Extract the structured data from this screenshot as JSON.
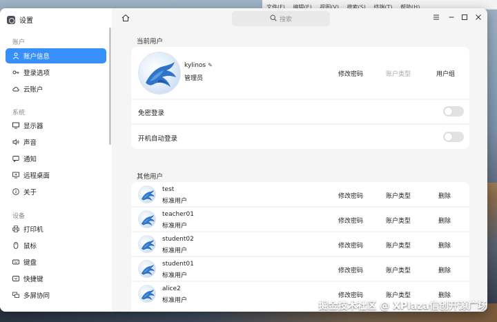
{
  "background_menubar": [
    "文件(F)",
    "编辑(E)",
    "视图(V)",
    "搜索(S)",
    "终端(T)",
    "帮助(H)"
  ],
  "watermark": "掘金技术社区 @ XPlaza信创开源广场",
  "window": {
    "title": "设置",
    "search_placeholder": "搜索"
  },
  "sidebar": {
    "sections": [
      {
        "label": "账户",
        "items": [
          {
            "label": "账户信息",
            "icon": "user-icon",
            "active": true
          },
          {
            "label": "登录选项",
            "icon": "key-icon"
          },
          {
            "label": "云账户",
            "icon": "cloud-icon"
          }
        ]
      },
      {
        "label": "系统",
        "items": [
          {
            "label": "显示器",
            "icon": "monitor-icon"
          },
          {
            "label": "声音",
            "icon": "speaker-icon"
          },
          {
            "label": "通知",
            "icon": "notification-icon"
          },
          {
            "label": "远程桌面",
            "icon": "remote-desktop-icon"
          },
          {
            "label": "关于",
            "icon": "info-icon"
          }
        ]
      },
      {
        "label": "设备",
        "items": [
          {
            "label": "打印机",
            "icon": "printer-icon"
          },
          {
            "label": "鼠标",
            "icon": "mouse-icon"
          },
          {
            "label": "键盘",
            "icon": "keyboard-icon"
          },
          {
            "label": "快捷键",
            "icon": "shortcut-icon"
          },
          {
            "label": "多屏协同",
            "icon": "multiscreen-icon"
          }
        ]
      }
    ]
  },
  "current_user": {
    "section_title": "当前用户",
    "name": "kylinos",
    "role": "管理员",
    "change_password": "修改密码",
    "account_type": "账户类型",
    "user_group": "用户组",
    "passwordless_login": "免密登录",
    "auto_login": "开机自动登录"
  },
  "other_users": {
    "section_title": "其他用户",
    "change_password": "修改密码",
    "account_type": "账户类型",
    "delete": "删除",
    "users": [
      {
        "name": "test",
        "role": "标准用户"
      },
      {
        "name": "teacher01",
        "role": "标准用户"
      },
      {
        "name": "student02",
        "role": "标准用户"
      },
      {
        "name": "student01",
        "role": "标准用户"
      },
      {
        "name": "alice2",
        "role": "标准用户"
      }
    ]
  },
  "colors": {
    "accent": "#3790fa",
    "panel_bg": "#f5f5f5",
    "card_bg": "#ffffff"
  }
}
